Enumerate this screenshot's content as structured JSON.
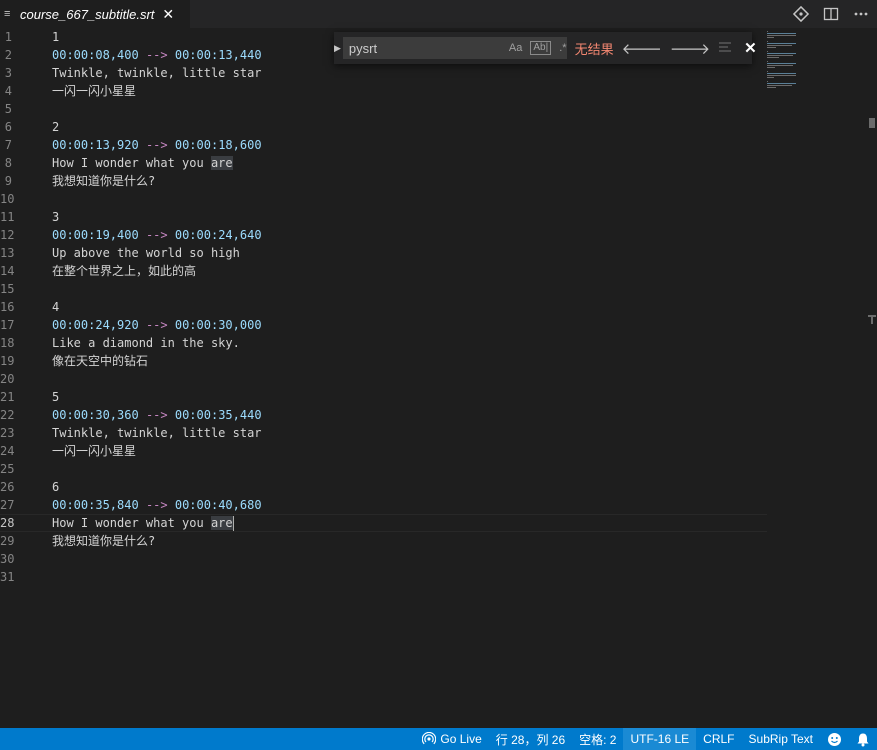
{
  "tab": {
    "title": "course_667_subtitle.srt",
    "icon": "lines-icon",
    "close": "✕"
  },
  "find": {
    "query": "pysrt",
    "options": {
      "match_case": "Aa",
      "whole_word": "Ab|",
      "regex": ".*"
    },
    "status": "无结果"
  },
  "lines": [
    {
      "n": "1",
      "text": "1",
      "kind": "num"
    },
    {
      "n": "2",
      "start": "00:00:08,400",
      "arrow": "-->",
      "end": "00:00:13,440",
      "kind": "time"
    },
    {
      "n": "3",
      "text": "Twinkle, twinkle, little star",
      "kind": "text"
    },
    {
      "n": "4",
      "text": "一闪一闪小星星",
      "kind": "text"
    },
    {
      "n": "5",
      "text": "",
      "kind": "text"
    },
    {
      "n": "6",
      "text": "2",
      "kind": "num"
    },
    {
      "n": "7",
      "start": "00:00:13,920",
      "arrow": "-->",
      "end": "00:00:18,600",
      "kind": "time"
    },
    {
      "n": "8",
      "text": "How I wonder what you ",
      "hl": "are",
      "kind": "text"
    },
    {
      "n": "9",
      "text": "我想知道你是什么?",
      "kind": "text"
    },
    {
      "n": "10",
      "text": "",
      "kind": "text"
    },
    {
      "n": "11",
      "text": "3",
      "kind": "num"
    },
    {
      "n": "12",
      "start": "00:00:19,400",
      "arrow": "-->",
      "end": "00:00:24,640",
      "kind": "time"
    },
    {
      "n": "13",
      "text": "Up above the world so high",
      "kind": "text"
    },
    {
      "n": "14",
      "text": "在整个世界之上，如此的高",
      "kind": "text"
    },
    {
      "n": "15",
      "text": "",
      "kind": "text"
    },
    {
      "n": "16",
      "text": "4",
      "kind": "num"
    },
    {
      "n": "17",
      "start": "00:00:24,920",
      "arrow": "-->",
      "end": "00:00:30,000",
      "kind": "time"
    },
    {
      "n": "18",
      "text": "Like a diamond in the sky.",
      "kind": "text"
    },
    {
      "n": "19",
      "text": "像在天空中的钻石",
      "kind": "text"
    },
    {
      "n": "20",
      "text": "",
      "kind": "text"
    },
    {
      "n": "21",
      "text": "5",
      "kind": "num"
    },
    {
      "n": "22",
      "start": "00:00:30,360",
      "arrow": "-->",
      "end": "00:00:35,440",
      "kind": "time"
    },
    {
      "n": "23",
      "text": "Twinkle, twinkle, little star",
      "kind": "text"
    },
    {
      "n": "24",
      "text": "一闪一闪小星星",
      "kind": "text"
    },
    {
      "n": "25",
      "text": "",
      "kind": "text"
    },
    {
      "n": "26",
      "text": "6",
      "kind": "num"
    },
    {
      "n": "27",
      "start": "00:00:35,840",
      "arrow": "-->",
      "end": "00:00:40,680",
      "kind": "time"
    },
    {
      "n": "28",
      "text": "How I wonder what you ",
      "hl": "are",
      "kind": "text",
      "active": true,
      "cursor": true
    },
    {
      "n": "29",
      "text": "我想知道你是什么?",
      "kind": "text"
    },
    {
      "n": "30",
      "text": "",
      "kind": "text"
    },
    {
      "n": "31",
      "text": "",
      "kind": "text"
    }
  ],
  "status": {
    "go_live": "Go Live",
    "position": "行 28，列 26",
    "spaces": "空格: 2",
    "encoding": "UTF-16 LE",
    "eol": "CRLF",
    "language": "SubRip Text"
  },
  "colors": {
    "accent": "#007acc",
    "time": "#9cdcfe",
    "arrow": "#c586c0",
    "error": "#f48771"
  }
}
